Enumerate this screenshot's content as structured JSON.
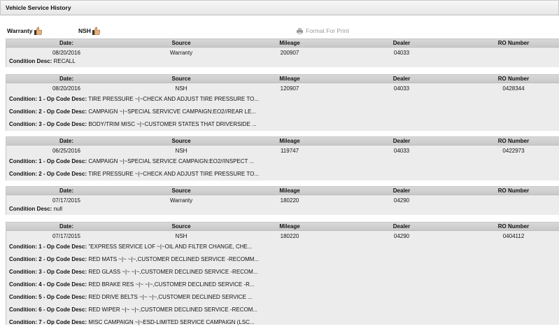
{
  "title": "Vehicle Service History",
  "legend": {
    "warranty": "Warranty",
    "nsh": "NSH"
  },
  "print_label": "Format For Print",
  "headers": {
    "date": "Date:",
    "source": "Source",
    "mileage": "Mileage",
    "dealer": "Dealer",
    "ro": "RO Number"
  },
  "cond_desc_label": "Condition Desc:",
  "records": [
    {
      "date": "08/20/2016",
      "source": "Warranty",
      "mileage": "200907",
      "dealer": "04033",
      "ro": "",
      "condition_desc": "RECALL",
      "conditions": []
    },
    {
      "date": "08/20/2016",
      "source": "NSH",
      "mileage": "120907",
      "dealer": "04033",
      "ro": "0428344",
      "conditions": [
        {
          "label": "Condition: 1 - Op Code Desc:",
          "text": "TIRE PRESSURE ~|~CHECK AND ADJUST TIRE PRESSURE TO..."
        },
        {
          "label": "Condition: 2 - Op Code Desc:",
          "text": "CAMPAIGN ~|~SPECIAL SERVICVE CAMPAIGN:EO2//REAR LE..."
        },
        {
          "label": "Condition: 3 - Op Code Desc:",
          "text": "BODY/TRIM MISC ~|~CUSTOMER STATES THAT DRIVERSIDE ..."
        }
      ]
    },
    {
      "date": "06/25/2016",
      "source": "NSH",
      "mileage": "119747",
      "dealer": "04033",
      "ro": "0422973",
      "conditions": [
        {
          "label": "Condition: 1 - Op Code Desc:",
          "text": "CAMPAIGN ~|~SPECIAL SERVICE CAMPAIGN:EO2//INSPECT ..."
        },
        {
          "label": "Condition: 2 - Op Code Desc:",
          "text": "TIRE PRESSURE ~|~CHECK AND ADJUST TIRE PRESSURE TO..."
        }
      ]
    },
    {
      "date": "07/17/2015",
      "source": "Warranty",
      "mileage": "180220",
      "dealer": "04290",
      "ro": "",
      "condition_desc": "null",
      "conditions": []
    },
    {
      "date": "07/17/2015",
      "source": "NSH",
      "mileage": "180220",
      "dealer": "04290",
      "ro": "0404112",
      "conditions": [
        {
          "label": "Condition: 1 - Op Code Desc:",
          "text": "\"EXPRESS SERVICE LOF ~|~OIL AND FILTER CHANGE, CHE..."
        },
        {
          "label": "Condition: 2 - Op Code Desc:",
          "text": "RED MATS ~|~ ~|~,CUSTOMER DECLINED SERVICE -RECOMM..."
        },
        {
          "label": "Condition: 3 - Op Code Desc:",
          "text": "RED GLASS ~|~ ~|~,CUSTOMER DECLINED SERVICE -RECOM..."
        },
        {
          "label": "Condition: 4 - Op Code Desc:",
          "text": "RED BRAKE RES ~|~ ~|~,CUSTOMER DECLINED SERVICE -R..."
        },
        {
          "label": "Condition: 5 - Op Code Desc:",
          "text": "RED DRIVE BELTS ~|~ ~|~,CUSTOMER DECLINED SERVICE ..."
        },
        {
          "label": "Condition: 6 - Op Code Desc:",
          "text": "RED WIPER ~|~ ~|~,CUSTOMER DECLINED SERVICE -RECOM..."
        },
        {
          "label": "Condition: 7 - Op Code Desc:",
          "text": "MISC CAMPAIGN ~|~ESD-LIMITED SERVICE CAMPAIGN (LSC..."
        }
      ]
    }
  ]
}
